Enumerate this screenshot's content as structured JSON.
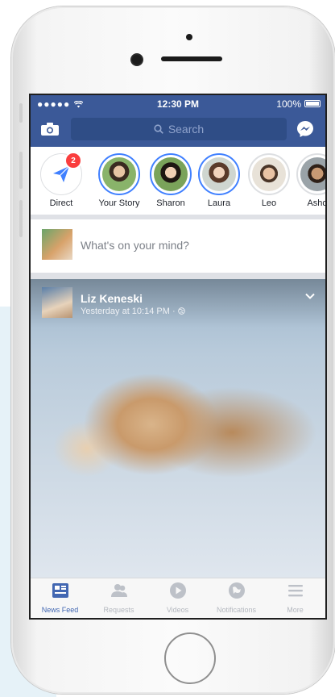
{
  "status_bar": {
    "signal": "●●●●● ",
    "time": "12:30 PM",
    "battery": "100%"
  },
  "nav": {
    "search_placeholder": "Search"
  },
  "stories": [
    {
      "label": "Direct",
      "badge": "2"
    },
    {
      "label": "Your Story"
    },
    {
      "label": "Sharon"
    },
    {
      "label": "Laura"
    },
    {
      "label": "Leo"
    },
    {
      "label": "Asho"
    }
  ],
  "composer": {
    "prompt": "What's on your mind?"
  },
  "post": {
    "author": "Liz Keneski",
    "time": "Yesterday at 10:14 PM · "
  },
  "tabs": [
    {
      "label": "News Feed",
      "icon": "news-feed-icon"
    },
    {
      "label": "Requests",
      "icon": "requests-icon"
    },
    {
      "label": "Videos",
      "icon": "videos-icon"
    },
    {
      "label": "Notifications",
      "icon": "notifications-icon"
    },
    {
      "label": "More",
      "icon": "more-icon"
    }
  ],
  "colors": {
    "brand": "#3b5998",
    "search": "#2f4d86",
    "accent": "#4080ff",
    "badge": "#fa3e3e",
    "tab_active": "#4267b2"
  }
}
